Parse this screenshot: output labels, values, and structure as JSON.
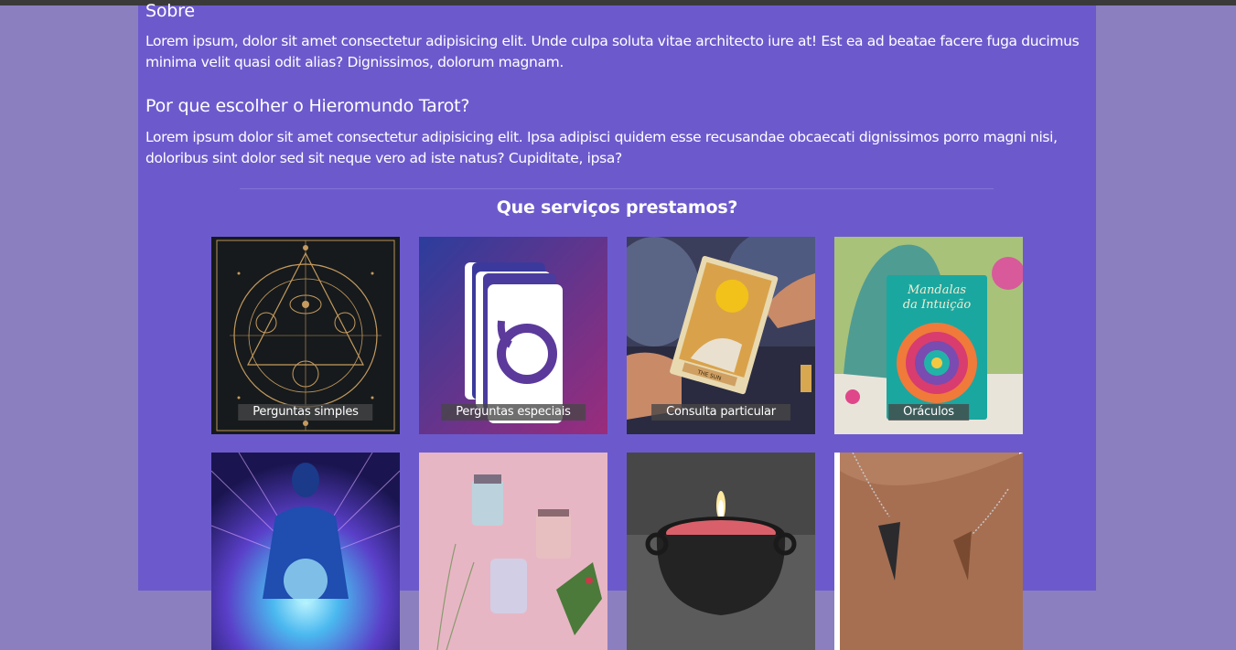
{
  "about": {
    "title": "Sobre",
    "text": "Lorem ipsum, dolor sit amet consectetur adipisicing elit. Unde culpa soluta vitae architecto iure at! Est ea ad beatae facere fuga ducimus minima velit quasi odit alias? Dignissimos, dolorum magnam."
  },
  "why": {
    "title": "Por que escolher o Hieromundo Tarot?",
    "text": "Lorem ipsum dolor sit amet consectetur adipisicing elit. Ipsa adipisci quidem esse recusandae obcaecati dignissimos porro magni nisi, doloribus sint dolor sed sit neque vero ad iste natus? Cupiditate, ipsa?"
  },
  "services": {
    "title": "Que serviços prestamos?",
    "cards": [
      {
        "label": "Perguntas simples",
        "image": "sacred-geometry-illustration"
      },
      {
        "label": "Perguntas especiais",
        "image": "tarot-cards-logo"
      },
      {
        "label": "Consulta particular",
        "image": "tarot-card-sun-photo"
      },
      {
        "label": "Oráculos",
        "image": "mandalas-da-intuicao-deck"
      },
      {
        "label": "",
        "image": "meditation-aura-silhouette"
      },
      {
        "label": "",
        "image": "scented-candles-photo"
      },
      {
        "label": "",
        "image": "cauldron-candle-photo"
      },
      {
        "label": "",
        "image": "pendulums-photo"
      }
    ]
  },
  "artwork": {
    "card4_title_line1": "Mandalas",
    "card4_title_line2": "da Intuição",
    "card3_banner": "THE SUN"
  },
  "colors": {
    "page_bg": "#8c7fbf",
    "content_bg": "#6c5acd",
    "text": "#ffffff",
    "label_bg": "#464646"
  }
}
